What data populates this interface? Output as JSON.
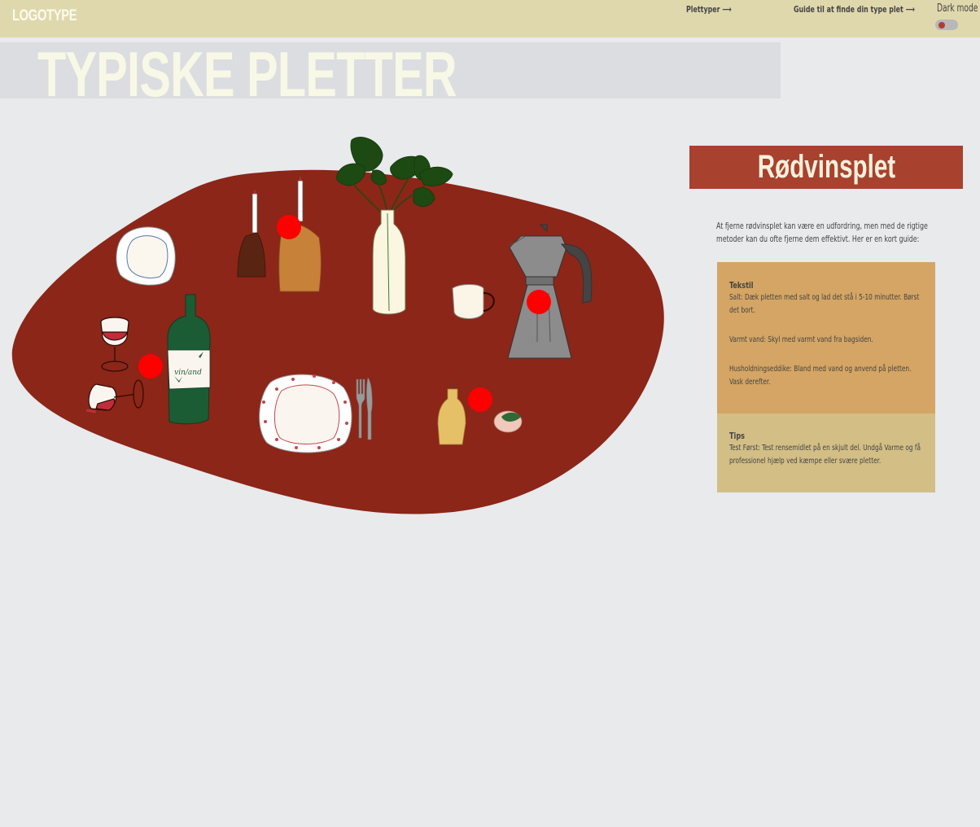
{
  "header": {
    "logo": "LOGOTYPE",
    "nav": [
      {
        "label": "Plettyper ⟶"
      },
      {
        "label": "Guide til at finde din type plet ⟶"
      }
    ],
    "dark_mode_label": "Dark mode"
  },
  "hero": {
    "title": "TYPISKE PLETTER"
  },
  "scene": {
    "bottle_label": "vin/and",
    "hotspot_color": "#ff0000",
    "table_color": "#8b2618"
  },
  "panel": {
    "title": "Rødvinsplet",
    "intro": "At fjerne rødvinsplet kan være en udfordring, men med de rigtige metoder kan du ofte fjerne dem effektivt. Her er en kort guide:",
    "textile": {
      "heading": "Tekstil",
      "items": [
        "Salt: Dæk pletten med salt og lad det stå i 5-10 minutter. Børst det bort.",
        "Varmt vand: Skyl med varmt vand fra bagsiden.",
        "Husholdningseddike: Bland med vand og anvend på pletten. Vask derefter."
      ]
    },
    "tips": {
      "heading": "Tips",
      "text": "Test Først: Test rensemidlet på en skjult del. Undgå Varme og få professionel hjælp ved kæmpe eller svære pletter."
    }
  }
}
